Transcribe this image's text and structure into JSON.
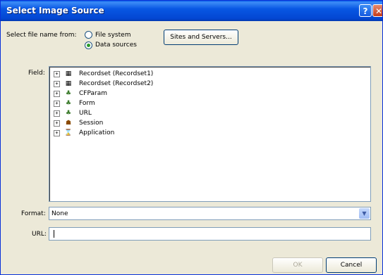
{
  "window": {
    "title": "Select Image Source"
  },
  "source": {
    "label": "Select file name from:",
    "options": [
      {
        "label": "File system",
        "selected": false
      },
      {
        "label": "Data sources",
        "selected": true
      }
    ],
    "sites_button": "Sites and Servers..."
  },
  "field": {
    "label": "Field:",
    "items": [
      {
        "label": "Recordset (Recordset1)",
        "icon": "recordset-icon"
      },
      {
        "label": "Recordset (Recordset2)",
        "icon": "recordset-icon"
      },
      {
        "label": "CFParam",
        "icon": "cfparam-icon"
      },
      {
        "label": "Form",
        "icon": "form-icon"
      },
      {
        "label": "URL",
        "icon": "url-icon"
      },
      {
        "label": "Session",
        "icon": "session-icon"
      },
      {
        "label": "Application",
        "icon": "application-icon"
      }
    ]
  },
  "format": {
    "label": "Format:",
    "value": "None"
  },
  "url": {
    "label": "URL:",
    "value": ""
  },
  "buttons": {
    "ok": "OK",
    "cancel": "Cancel"
  },
  "colors": {
    "titlebar": "#0857e3",
    "dialog": "#ece9d8",
    "border": "#7f9db9"
  }
}
